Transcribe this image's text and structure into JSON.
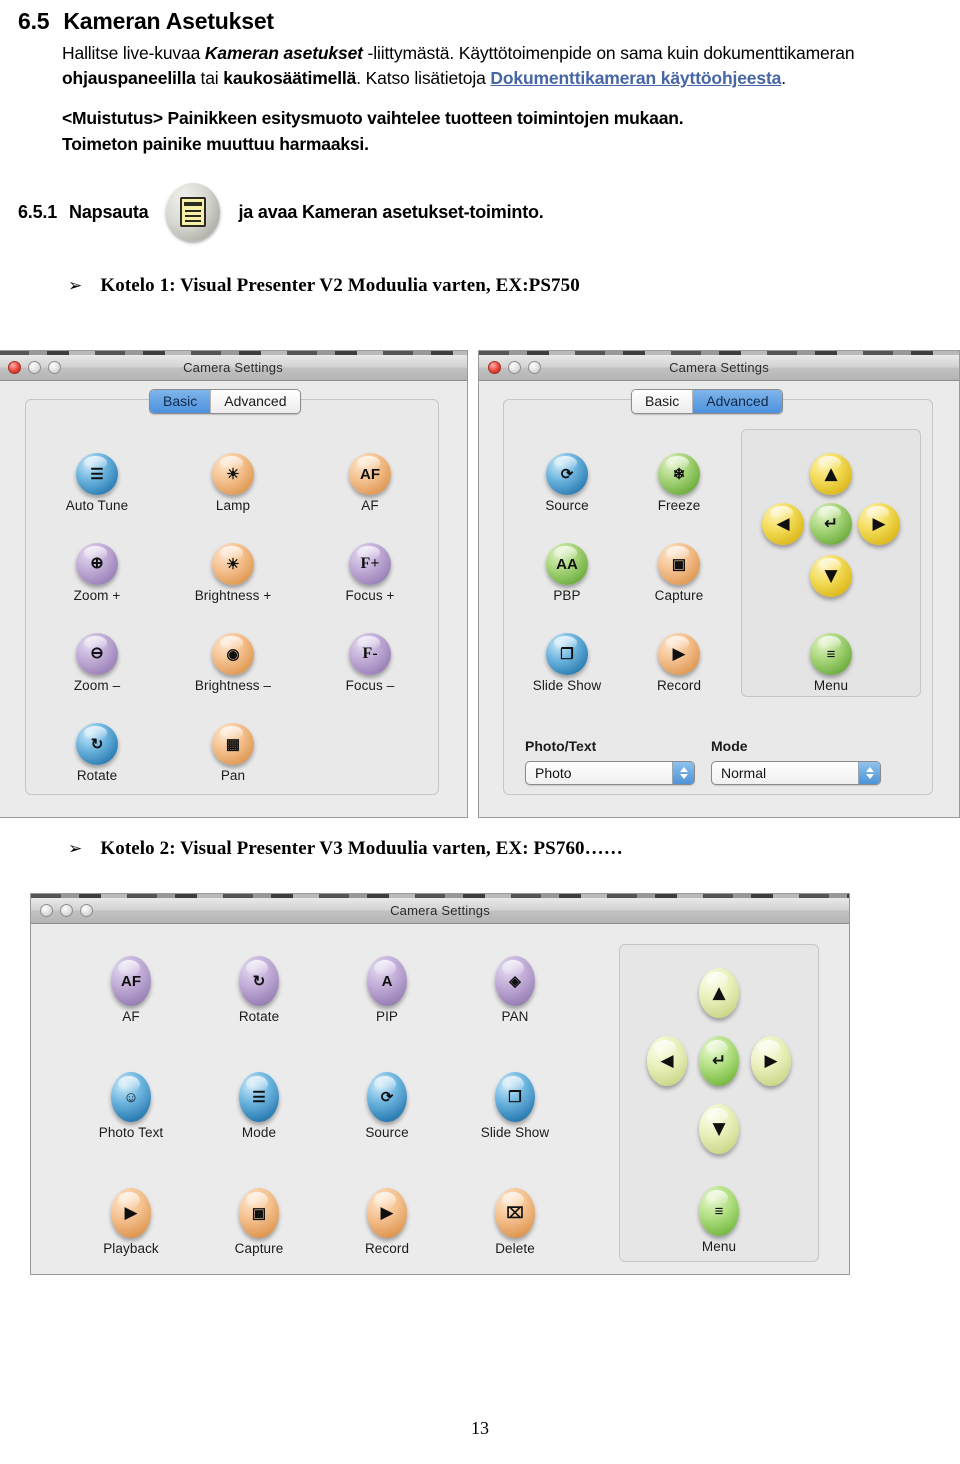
{
  "document": {
    "heading_number": "6.5",
    "heading_title": "Kameran Asetukset",
    "para_part1": "Hallitse live-kuvaa ",
    "para_em1": "Kameran asetukset",
    "para_part2": " -liittymästä. Käyttötoimenpide on sama kuin dokumenttikameran ",
    "para_b1": "ohjauspaneelilla",
    "para_part3": " tai ",
    "para_b2": "kaukosäätimellä",
    "para_part4": ". Katso lisätietoja ",
    "para_link": "Dokumenttikameran käyttöohjeesta",
    "para_part5": ".",
    "note_line1": "<Muistutus> Painikkeen esitysmuoto vaihtelee tuotteen toimintojen mukaan.",
    "note_line2": "Toimeton painike muuttuu harmaaksi.",
    "step_number": "6.5.1",
    "step_text_before": "Napsauta",
    "step_text_after": "ja avaa Kameran asetukset-toiminto.",
    "step_icon_name": "menu-document-icon",
    "bullet_glyph": "➢",
    "caption_case1": "Kotelo 1: Visual Presenter V2 Moduulia varten, EX:PS750",
    "caption_case2": "Kotelo 2: Visual Presenter V3 Moduulia varten, EX: PS760……",
    "page_number": "13"
  },
  "window_basic": {
    "title": "Camera Settings",
    "tabs": [
      {
        "label": "Basic",
        "active": true
      },
      {
        "label": "Advanced",
        "active": false
      }
    ],
    "icons": [
      {
        "label": "Auto Tune",
        "color": "blue",
        "glyph": "☰",
        "icon_name": "auto-tune-icon"
      },
      {
        "label": "Lamp",
        "color": "orange",
        "glyph": "☀",
        "icon_name": "lamp-icon"
      },
      {
        "label": "AF",
        "color": "orange",
        "glyph": "AF",
        "icon_name": "af-icon"
      },
      {
        "label": "Zoom +",
        "color": "purple",
        "glyph": "⊕",
        "icon_name": "zoom-in-icon"
      },
      {
        "label": "Brightness +",
        "color": "orange",
        "glyph": "☀",
        "icon_name": "brightness-up-icon"
      },
      {
        "label": "Focus +",
        "color": "purple",
        "glyph": "F+",
        "icon_name": "focus-plus-icon"
      },
      {
        "label": "Zoom –",
        "color": "purple",
        "glyph": "⊖",
        "icon_name": "zoom-out-icon"
      },
      {
        "label": "Brightness –",
        "color": "orange",
        "glyph": "◉",
        "icon_name": "brightness-down-icon"
      },
      {
        "label": "Focus –",
        "color": "purple",
        "glyph": "F-",
        "icon_name": "focus-minus-icon"
      },
      {
        "label": "Rotate",
        "color": "blue",
        "glyph": "↻",
        "icon_name": "rotate-icon"
      },
      {
        "label": "Pan",
        "color": "orange",
        "glyph": "▦",
        "icon_name": "pan-icon"
      }
    ]
  },
  "window_advanced": {
    "title": "Camera Settings",
    "tabs": [
      {
        "label": "Basic",
        "active": false
      },
      {
        "label": "Advanced",
        "active": true
      }
    ],
    "icons": [
      {
        "label": "Source",
        "color": "blue",
        "glyph": "⟳",
        "icon_name": "source-icon"
      },
      {
        "label": "Freeze",
        "color": "green",
        "glyph": "❄",
        "icon_name": "freeze-icon"
      },
      {
        "label": "PBP",
        "color": "green",
        "glyph": "AA",
        "icon_name": "pbp-icon"
      },
      {
        "label": "Capture",
        "color": "orange",
        "glyph": "▣",
        "icon_name": "capture-icon"
      },
      {
        "label": "Slide Show",
        "color": "blue",
        "glyph": "❐",
        "icon_name": "slide-show-icon"
      },
      {
        "label": "Record",
        "color": "orange",
        "glyph": "▶",
        "icon_name": "record-icon"
      }
    ],
    "keypad": {
      "up": "▲",
      "left": "◀",
      "enter": "↵",
      "right": "▶",
      "down": "▼",
      "menu_label": "Menu",
      "menu_glyph": "≡"
    },
    "fields": [
      {
        "label": "Photo/Text",
        "value": "Photo",
        "name": "photo-text-select"
      },
      {
        "label": "Mode",
        "value": "Normal",
        "name": "mode-select"
      }
    ]
  },
  "window_v3": {
    "title": "Camera Settings",
    "icons": [
      {
        "label": "AF",
        "color": "purple",
        "glyph": "AF",
        "icon_name": "af-icon"
      },
      {
        "label": "Rotate",
        "color": "purple",
        "glyph": "↻",
        "icon_name": "rotate-icon"
      },
      {
        "label": "PIP",
        "color": "purple",
        "glyph": "A",
        "icon_name": "pip-icon"
      },
      {
        "label": "PAN",
        "color": "purple",
        "glyph": "◈",
        "icon_name": "pan-icon"
      },
      {
        "label": "Photo Text",
        "color": "blue",
        "glyph": "☺",
        "icon_name": "photo-text-icon"
      },
      {
        "label": "Mode",
        "color": "blue",
        "glyph": "☰",
        "icon_name": "mode-icon"
      },
      {
        "label": "Source",
        "color": "blue",
        "glyph": "⟳",
        "icon_name": "source-icon"
      },
      {
        "label": "Slide Show",
        "color": "blue",
        "glyph": "❐",
        "icon_name": "slide-show-icon"
      },
      {
        "label": "Playback",
        "color": "orange",
        "glyph": "▶",
        "icon_name": "playback-icon"
      },
      {
        "label": "Capture",
        "color": "orange",
        "glyph": "▣",
        "icon_name": "capture-icon"
      },
      {
        "label": "Record",
        "color": "orange",
        "glyph": "▶",
        "icon_name": "record-icon"
      },
      {
        "label": "Delete",
        "color": "orange",
        "glyph": "⌧",
        "icon_name": "delete-icon"
      }
    ],
    "keypad": {
      "up": "▲",
      "left": "◀",
      "enter": "↵",
      "right": "▶",
      "down": "▼",
      "menu_label": "Menu",
      "menu_glyph": "≡"
    }
  },
  "colors": {
    "link": "#4766a5",
    "tab_active": "#4d91dd",
    "window_bg": "#ebebeb"
  }
}
